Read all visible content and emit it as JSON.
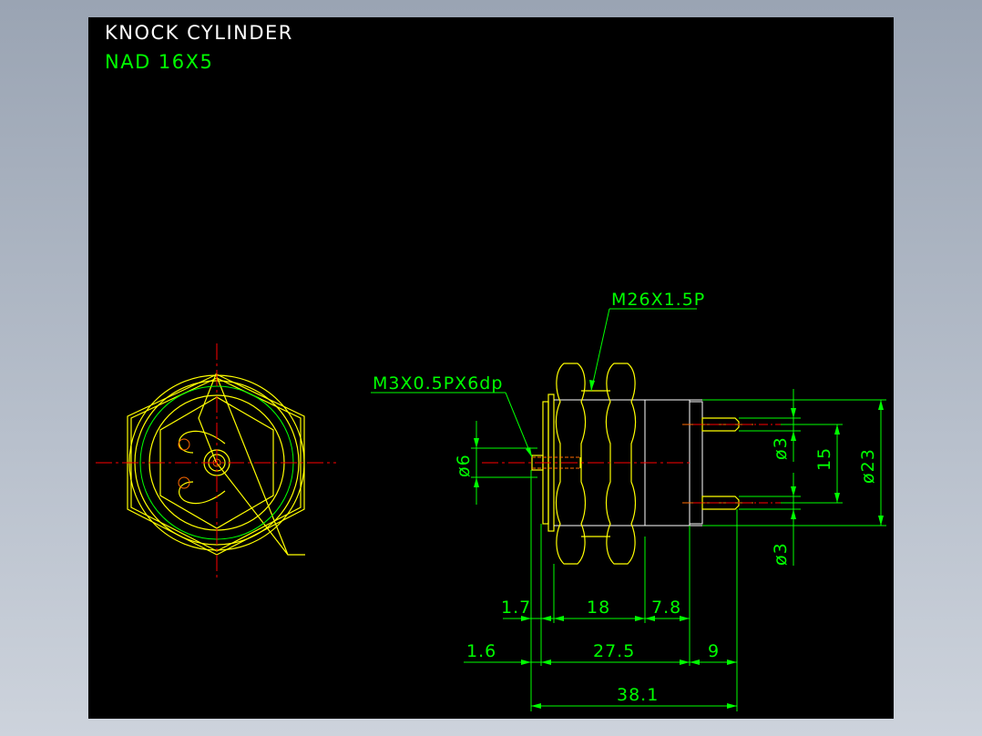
{
  "title": {
    "line1": "KNOCK CYLINDER",
    "line2": "NAD 16X5"
  },
  "colors": {
    "background": "#000000",
    "title_line1": "#ffffff",
    "title_line2": "#00ff00",
    "outline": "#ffff00",
    "dimension": "#00ff00",
    "centerline": "#ff0000"
  },
  "callouts": {
    "thread_main": "M26X1.5P",
    "thread_small": "M3X0.5PX6dp"
  },
  "dimensions": {
    "d6": "ø6",
    "d3_top": "ø3",
    "d3_bottom": "ø3",
    "d15": "15",
    "d23": "ø23",
    "d1_7": "1.7",
    "d18": "18",
    "d7_8": "7.8",
    "d1_6": "1.6",
    "d27_5": "27.5",
    "d9": "9",
    "d38_1": "38.1"
  }
}
